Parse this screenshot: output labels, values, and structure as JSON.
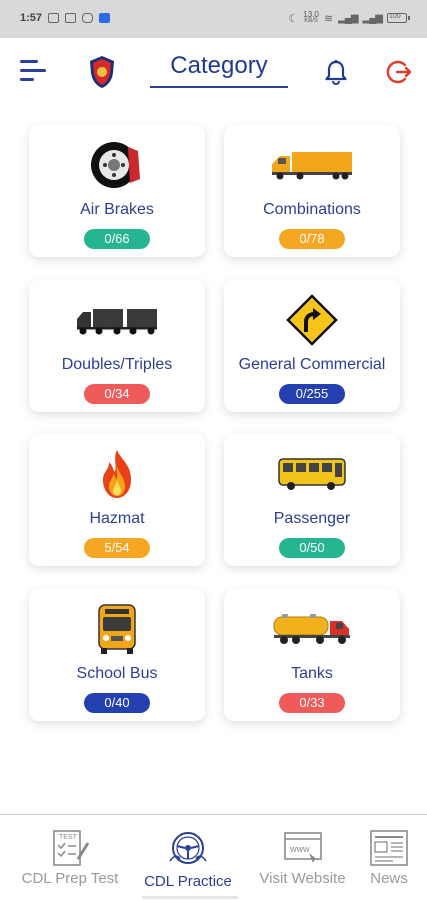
{
  "status_bar": {
    "time": "1:57",
    "network_speed_top": "13.0",
    "network_speed_bottom": "KB/S",
    "battery": "100"
  },
  "header": {
    "title": "Category"
  },
  "categories": [
    {
      "label": "Air Brakes",
      "progress": "0/66",
      "color": "#26b591",
      "icon": "brake-icon"
    },
    {
      "label": "Combinations",
      "progress": "0/78",
      "color": "#f5a623",
      "icon": "truck-icon"
    },
    {
      "label": "Doubles/Triples",
      "progress": "0/34",
      "color": "#ef5a5a",
      "icon": "double-trailer-icon"
    },
    {
      "label": "General Commercial",
      "progress": "0/255",
      "color": "#243fb0",
      "icon": "road-sign-icon"
    },
    {
      "label": "Hazmat",
      "progress": "5/54",
      "color": "#f5a623",
      "icon": "fire-icon"
    },
    {
      "label": "Passenger",
      "progress": "0/50",
      "color": "#26b591",
      "icon": "bus-icon"
    },
    {
      "label": "School Bus",
      "progress": "0/40",
      "color": "#243fb0",
      "icon": "school-bus-icon"
    },
    {
      "label": "Tanks",
      "progress": "0/33",
      "color": "#ef5a5a",
      "icon": "tanker-truck-icon"
    }
  ],
  "bottom_nav": [
    {
      "label": "CDL Prep Test",
      "icon": "test-sheet-icon",
      "active": false
    },
    {
      "label": "CDL Practice",
      "icon": "steering-wheel-icon",
      "active": true
    },
    {
      "label": "Visit Website",
      "icon": "www-icon",
      "active": false
    },
    {
      "label": "News",
      "icon": "newspaper-icon",
      "active": false
    }
  ]
}
